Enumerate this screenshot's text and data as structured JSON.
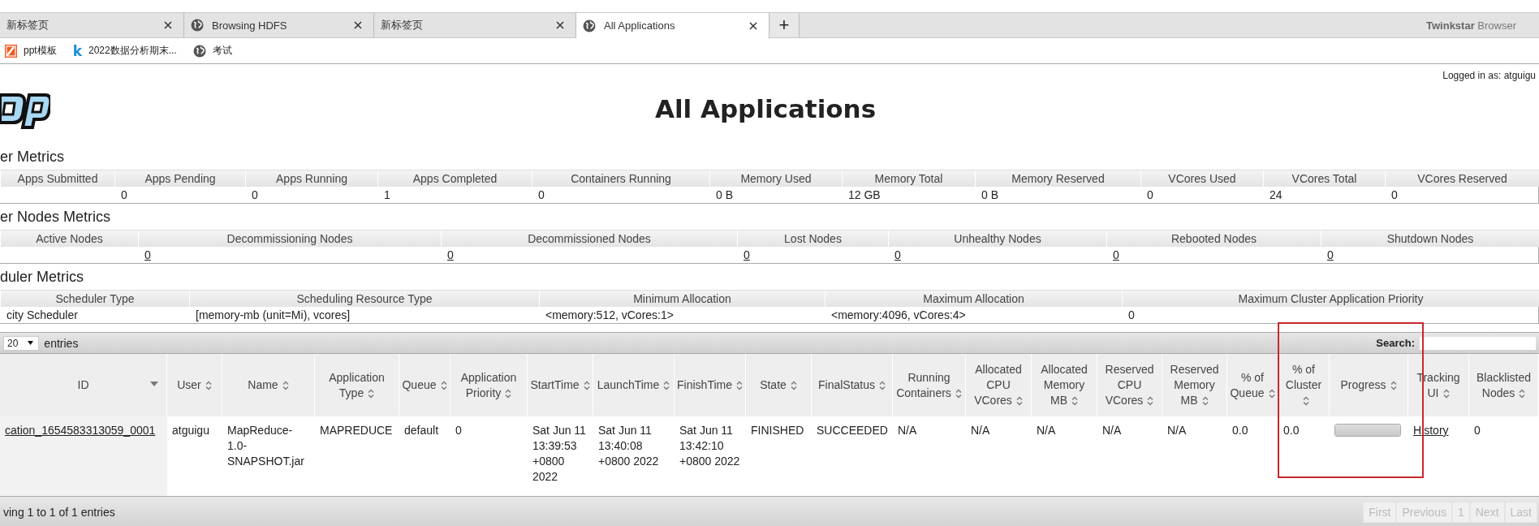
{
  "browser": {
    "tabs": [
      {
        "title": "新标签页",
        "icon": false,
        "selected": false
      },
      {
        "title": "Browsing HDFS",
        "icon": true,
        "selected": false
      },
      {
        "title": "新标签页",
        "icon": false,
        "selected": false
      },
      {
        "title": "All Applications",
        "icon": true,
        "selected": true
      }
    ],
    "new_tab": "+",
    "brand": {
      "name": "Twinkstar",
      "suffix": "Browser"
    }
  },
  "bookmarks": [
    {
      "kind": "slides",
      "label": "ppt模板"
    },
    {
      "kind": "letter",
      "glyph": "k",
      "label": "2022数据分析期末..."
    },
    {
      "kind": "globe",
      "label": "考试"
    }
  ],
  "page": {
    "logged_in": "Logged in as: atguigu",
    "title": "All Applications"
  },
  "cluster_metrics": {
    "heading": "er Metrics",
    "links": false,
    "columns": [
      "Apps Submitted",
      "Apps Pending",
      "Apps Running",
      "Apps Completed",
      "Containers Running",
      "Memory Used",
      "Memory Total",
      "Memory Reserved",
      "VCores Used",
      "VCores Total",
      "VCores Reserved"
    ],
    "values": [
      "0",
      "0",
      "1",
      "0",
      "0 B",
      "12 GB",
      "0 B",
      "0",
      "24",
      "0"
    ]
  },
  "nodes_metrics": {
    "heading": "er Nodes Metrics",
    "links": true,
    "columns": [
      "Active Nodes",
      "Decommissioning Nodes",
      "Decommissioned Nodes",
      "Lost Nodes",
      "Unhealthy Nodes",
      "Rebooted Nodes",
      "Shutdown Nodes"
    ],
    "values": [
      "0",
      "0",
      "0",
      "0",
      "0",
      "0"
    ]
  },
  "scheduler_metrics": {
    "heading": "duler Metrics",
    "links": false,
    "columns": [
      "Scheduler Type",
      "Scheduling Resource Type",
      "Minimum Allocation",
      "Maximum Allocation",
      "Maximum Cluster Application Priority"
    ],
    "values": [
      "city Scheduler",
      "[memory-mb (unit=Mi), vcores]",
      "<memory:512, vCores:1>",
      "<memory:4096, vCores:4>",
      "0"
    ]
  },
  "applications": {
    "page_size": "20",
    "entries_label": "entries",
    "search_label": "Search:",
    "columns": [
      {
        "label": "ID",
        "sorted": true
      },
      {
        "label": "User",
        "sorted": false
      },
      {
        "label": "Name",
        "sorted": false
      },
      {
        "label": "Application Type",
        "sorted": false
      },
      {
        "label": "Queue",
        "sorted": false
      },
      {
        "label": "Application Priority",
        "sorted": false
      },
      {
        "label": "StartTime",
        "sorted": false
      },
      {
        "label": "LaunchTime",
        "sorted": false
      },
      {
        "label": "FinishTime",
        "sorted": false
      },
      {
        "label": "State",
        "sorted": false
      },
      {
        "label": "FinalStatus",
        "sorted": false
      },
      {
        "label": "Running Containers",
        "sorted": false
      },
      {
        "label": "Allocated CPU VCores",
        "sorted": false
      },
      {
        "label": "Allocated Memory MB",
        "sorted": false
      },
      {
        "label": "Reserved CPU VCores",
        "sorted": false
      },
      {
        "label": "Reserved Memory MB",
        "sorted": false
      },
      {
        "label": "% of Queue",
        "sorted": false
      },
      {
        "label": "% of Cluster",
        "sorted": false
      },
      {
        "label": "Progress",
        "sorted": false
      },
      {
        "label": "Tracking UI",
        "sorted": false
      },
      {
        "label": "Blacklisted Nodes",
        "sorted": false
      }
    ],
    "rows": [
      {
        "cells": [
          {
            "kind": "link",
            "text": "cation_1654583313059_0001"
          },
          {
            "kind": "text",
            "text": "atguigu"
          },
          {
            "kind": "text",
            "text": "MapReduce-1.0-SNAPSHOT.jar"
          },
          {
            "kind": "text",
            "text": "MAPREDUCE"
          },
          {
            "kind": "text",
            "text": "default"
          },
          {
            "kind": "text",
            "text": "0"
          },
          {
            "kind": "text",
            "text": "Sat Jun 11 13:39:53 +0800 2022"
          },
          {
            "kind": "text",
            "text": "Sat Jun 11 13:40:08 +0800 2022"
          },
          {
            "kind": "text",
            "text": "Sat Jun 11 13:42:10 +0800 2022"
          },
          {
            "kind": "text",
            "text": "FINISHED"
          },
          {
            "kind": "text",
            "text": "SUCCEEDED"
          },
          {
            "kind": "text",
            "text": "N/A"
          },
          {
            "kind": "text",
            "text": "N/A"
          },
          {
            "kind": "text",
            "text": "N/A"
          },
          {
            "kind": "text",
            "text": "N/A"
          },
          {
            "kind": "text",
            "text": "N/A"
          },
          {
            "kind": "text",
            "text": "0.0"
          },
          {
            "kind": "text",
            "text": "0.0"
          },
          {
            "kind": "progress",
            "level": 1
          },
          {
            "kind": "link",
            "text": "History"
          },
          {
            "kind": "text",
            "text": "0"
          }
        ]
      }
    ],
    "info": "ving 1 to 1 of 1 entries",
    "pagination": [
      {
        "label": "First",
        "disabled": true
      },
      {
        "label": "Previous",
        "disabled": true
      },
      {
        "label": "1",
        "disabled": true
      },
      {
        "label": "Next",
        "disabled": true
      },
      {
        "label": "Last",
        "disabled": true
      }
    ]
  }
}
